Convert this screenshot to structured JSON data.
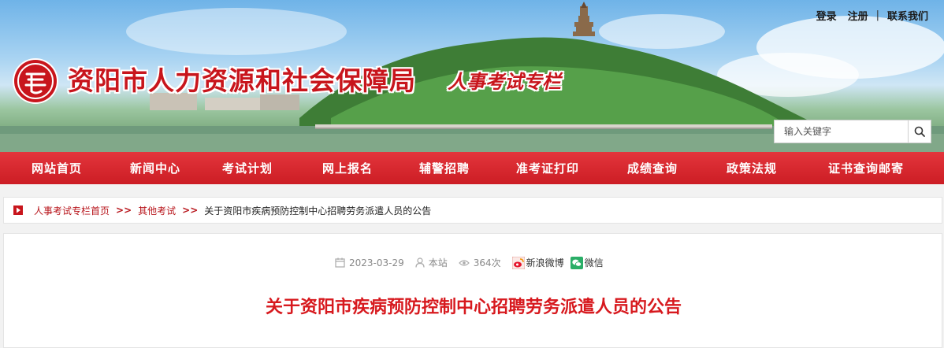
{
  "header": {
    "site_title": "资阳市人力资源和社会保障局",
    "sub_title": "人事考试专栏",
    "top_links": {
      "login": "登录",
      "register": "注册",
      "separator": "|",
      "contact": "联系我们"
    },
    "search": {
      "placeholder": "输入关键字",
      "icon": "search-icon"
    }
  },
  "nav": {
    "items": [
      {
        "label": "网站首页"
      },
      {
        "label": "新闻中心"
      },
      {
        "label": "考试计划"
      },
      {
        "label": "网上报名"
      },
      {
        "label": "辅警招聘"
      },
      {
        "label": "准考证打印"
      },
      {
        "label": "成绩查询"
      },
      {
        "label": "政策法规"
      },
      {
        "label": "证书查询邮寄"
      }
    ]
  },
  "breadcrumb": {
    "items": [
      {
        "label": "人事考试专栏首页"
      },
      {
        "label": "其他考试"
      }
    ],
    "arrow": ">>",
    "current": "关于资阳市疾病预防控制中心招聘劳务派遣人员的公告"
  },
  "article": {
    "date": "2023-03-29",
    "source": "本站",
    "views": "364次",
    "share_weibo": "新浪微博",
    "share_wechat": "微信",
    "title": "关于资阳市疾病预防控制中心招聘劳务派遣人员的公告"
  },
  "colors": {
    "brand_red": "#cc1d24",
    "title_red": "#d7191e"
  }
}
